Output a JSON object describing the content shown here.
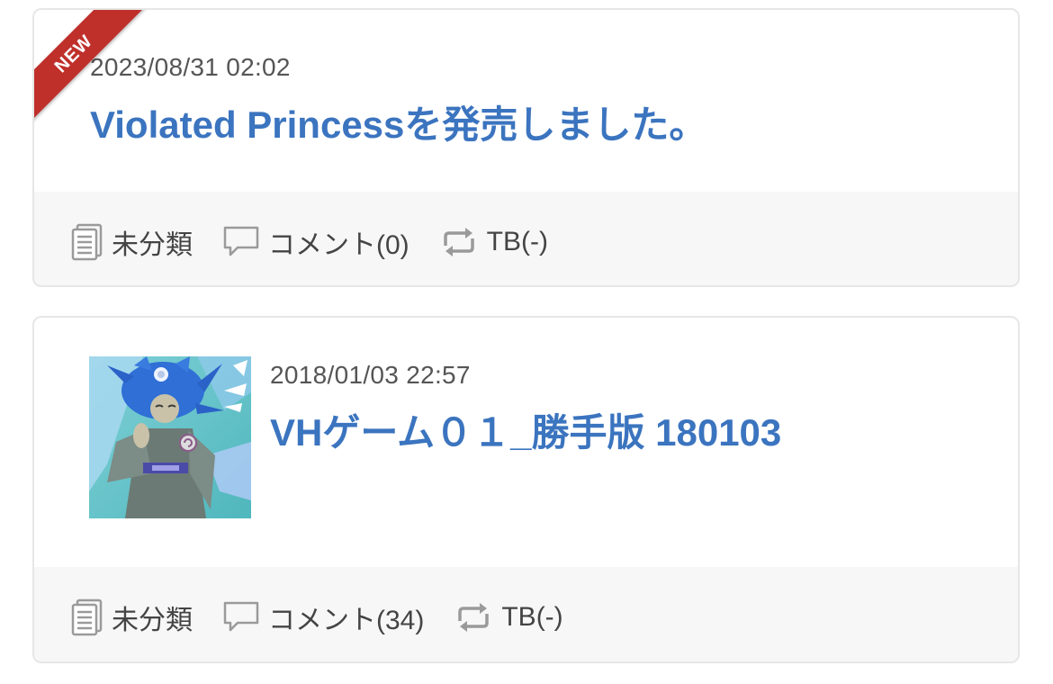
{
  "posts": [
    {
      "badge": "NEW",
      "date": "2023/08/31 02:02",
      "title": "Violated Princessを発売しました。",
      "category": "未分類",
      "comments": "コメント(0)",
      "trackback": "TB(-)"
    },
    {
      "date": "2018/01/03 22:57",
      "title": "VHゲーム０１_勝手版 180103",
      "category": "未分類",
      "comments": "コメント(34)",
      "trackback": "TB(-)"
    }
  ],
  "colors": {
    "title": "#3b74bf",
    "ribbon": "#c0302b",
    "footer_bg": "#f7f7f7",
    "border": "#e6e6e6"
  }
}
